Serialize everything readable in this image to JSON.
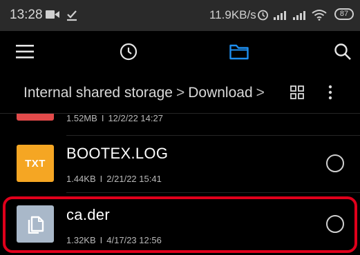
{
  "status_bar": {
    "time": "13:28",
    "network_speed": "11.9KB/s",
    "battery": "87",
    "icons": [
      "video-camera-icon",
      "download-check-icon",
      "alarm-icon",
      "signal-icon",
      "signal-icon",
      "wifi-icon",
      "battery-icon"
    ]
  },
  "toolbar": {
    "icons": [
      "menu-icon",
      "recent-clock-icon",
      "folder-icon",
      "search-icon"
    ],
    "active_color": "#1e8ff0"
  },
  "breadcrumb": {
    "items": [
      "Internal shared storage",
      "Download"
    ],
    "separator": ">"
  },
  "files": [
    {
      "name": "",
      "size": "1.52MB",
      "date": "12/2/22 14:27",
      "thumb_color": "#e24a4a"
    },
    {
      "name": "BOOTEX.LOG",
      "size": "1.44KB",
      "date": "2/21/22 15:41",
      "thumb_label": "TXT",
      "thumb_color": "#f5a623"
    },
    {
      "name": "ca.der",
      "size": "1.32KB",
      "date": "4/17/23 12:56",
      "thumb_color": "#a9b8c9",
      "highlighted": true,
      "highlight_color": "#e0001b"
    }
  ],
  "meta_separator": "I"
}
